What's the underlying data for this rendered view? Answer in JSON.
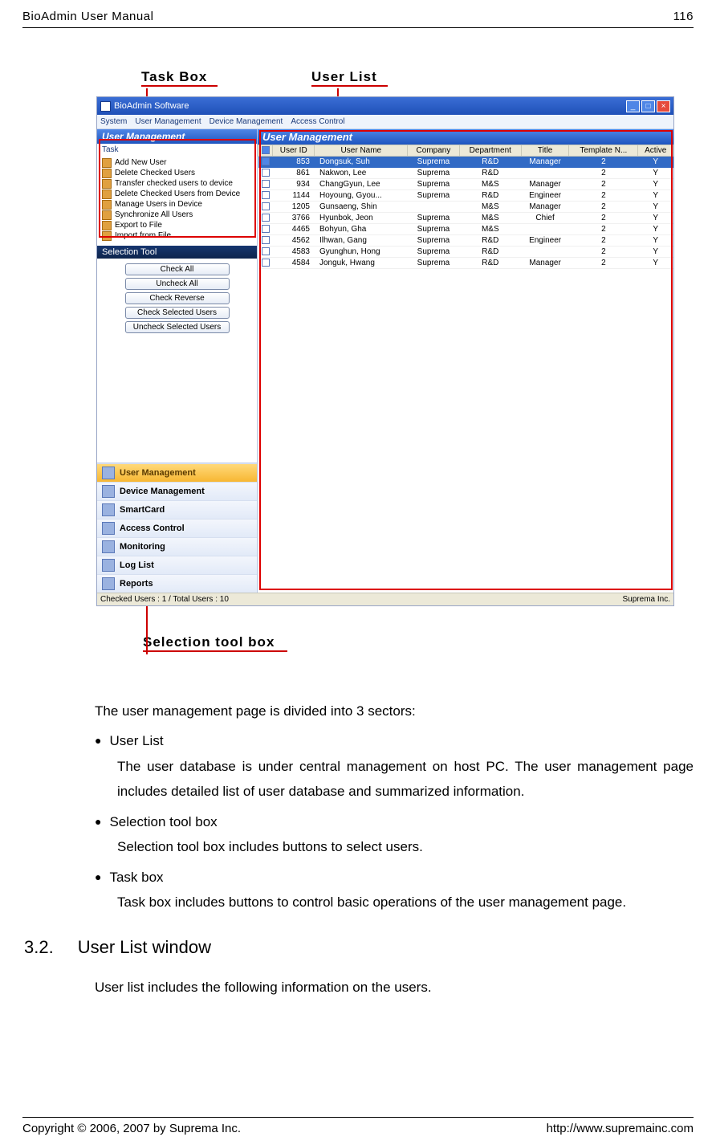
{
  "page": {
    "header_left": "BioAdmin User Manual",
    "header_right": "116",
    "footer_left": "Copyright © 2006, 2007 by Suprema Inc.",
    "footer_right": "http://www.supremainc.com"
  },
  "callouts": {
    "taskbox": "Task Box",
    "userlist": "User List",
    "seltool": "Selection tool box"
  },
  "app": {
    "title": "BioAdmin Software",
    "menus": [
      "System",
      "User Management",
      "Device Management",
      "Access Control"
    ],
    "panel_left_title": "User Management",
    "task_label": "Task",
    "tasks": [
      "Add New User",
      "Delete Checked Users",
      "Transfer checked users to device",
      "Delete Checked Users from Device",
      "Manage Users in Device",
      "Synchronize All Users",
      "Export to File",
      "Import from File"
    ],
    "seltool_title": "Selection Tool",
    "sel_buttons": [
      "Check All",
      "Uncheck All",
      "Check Reverse",
      "Check Selected Users",
      "Uncheck Selected Users"
    ],
    "nav": [
      "User Management",
      "Device Management",
      "SmartCard",
      "Access Control",
      "Monitoring",
      "Log List",
      "Reports"
    ],
    "content_title": "User Management",
    "columns": [
      "",
      "User ID",
      "User Name",
      "Company",
      "Department",
      "Title",
      "Template N...",
      "Active"
    ],
    "rows": [
      {
        "chk": true,
        "id": "853",
        "name": "Dongsuk, Suh",
        "co": "Suprema",
        "dept": "R&D",
        "title": "Manager",
        "tpl": "2",
        "active": "Y",
        "sel": true
      },
      {
        "chk": false,
        "id": "861",
        "name": "Nakwon, Lee",
        "co": "Suprema",
        "dept": "R&D",
        "title": "",
        "tpl": "2",
        "active": "Y"
      },
      {
        "chk": false,
        "id": "934",
        "name": "ChangGyun, Lee",
        "co": "Suprema",
        "dept": "M&S",
        "title": "Manager",
        "tpl": "2",
        "active": "Y"
      },
      {
        "chk": false,
        "id": "1144",
        "name": "Hoyoung, Gyou...",
        "co": "Suprema",
        "dept": "R&D",
        "title": "Engineer",
        "tpl": "2",
        "active": "Y"
      },
      {
        "chk": false,
        "id": "1205",
        "name": "Gunsaeng, Shin",
        "co": "",
        "dept": "M&S",
        "title": "Manager",
        "tpl": "2",
        "active": "Y"
      },
      {
        "chk": false,
        "id": "3766",
        "name": "Hyunbok, Jeon",
        "co": "Suprema",
        "dept": "M&S",
        "title": "Chief",
        "tpl": "2",
        "active": "Y"
      },
      {
        "chk": false,
        "id": "4465",
        "name": "Bohyun, Gha",
        "co": "Suprema",
        "dept": "M&S",
        "title": "",
        "tpl": "2",
        "active": "Y"
      },
      {
        "chk": false,
        "id": "4562",
        "name": "Ilhwan, Gang",
        "co": "Suprema",
        "dept": "R&D",
        "title": "Engineer",
        "tpl": "2",
        "active": "Y"
      },
      {
        "chk": false,
        "id": "4583",
        "name": "Gyunghun, Hong",
        "co": "Suprema",
        "dept": "R&D",
        "title": "",
        "tpl": "2",
        "active": "Y"
      },
      {
        "chk": false,
        "id": "4584",
        "name": "Jonguk, Hwang",
        "co": "Suprema",
        "dept": "R&D",
        "title": "Manager",
        "tpl": "2",
        "active": "Y"
      }
    ],
    "status_left": "Checked Users : 1 / Total Users : 10",
    "status_right": "Suprema Inc."
  },
  "doc": {
    "intro": "The user management page is divided into 3 sectors:",
    "b1_title": "User List",
    "b1_body": "The user database is under central management on host PC. The user management page includes detailed list of user database and summarized information.",
    "b2_title": "Selection tool box",
    "b2_body": "Selection tool box includes buttons to select users.",
    "b3_title": "Task box",
    "b3_body": "Task box includes buttons to control basic operations of the user management page.",
    "sec_num": "3.2.",
    "sec_title": "User List window",
    "sec_body": "User list includes the following information on the users."
  }
}
